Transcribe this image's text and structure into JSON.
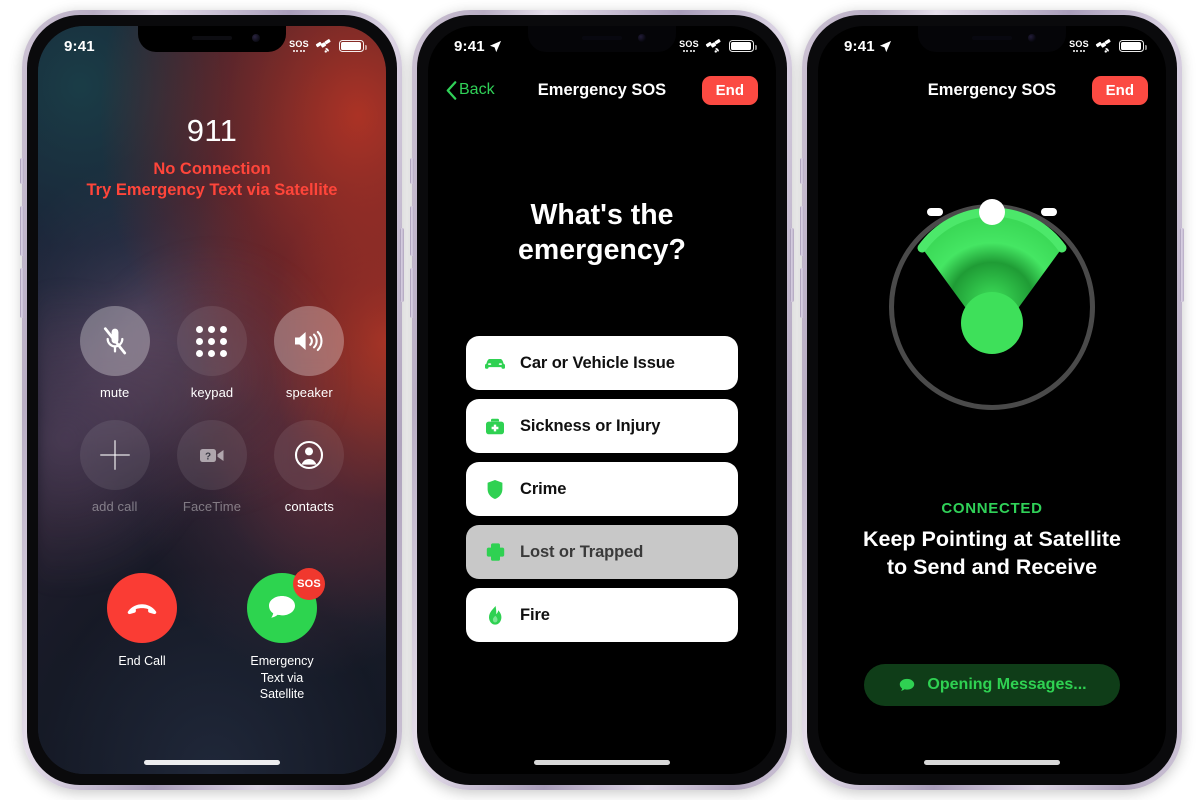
{
  "meta": {
    "accent_green": "#30d158",
    "accent_red": "#fb4a42",
    "bg": "#ffffff"
  },
  "status_bar": {
    "time": "9:41",
    "sos_label": "SOS",
    "location_icon": "location-arrow-icon",
    "satellite_icon": "satellite-icon",
    "battery_icon": "battery-icon"
  },
  "phone1": {
    "screen_name": "in-call-911",
    "call": {
      "number": "911",
      "status_line1": "No Connection",
      "status_line2": "Try Emergency Text via Satellite"
    },
    "controls": [
      {
        "id": "mute",
        "label": "mute",
        "icon": "microphone-slash-icon",
        "state": "on"
      },
      {
        "id": "keypad",
        "label": "keypad",
        "icon": "keypad-icon",
        "state": "off"
      },
      {
        "id": "speaker",
        "label": "speaker",
        "icon": "speaker-wave-icon",
        "state": "on"
      },
      {
        "id": "add-call",
        "label": "add call",
        "icon": "plus-icon",
        "state": "disabled"
      },
      {
        "id": "facetime",
        "label": "FaceTime",
        "icon": "video-camera-icon",
        "state": "disabled"
      },
      {
        "id": "contacts",
        "label": "contacts",
        "icon": "contact-person-icon",
        "state": "off"
      }
    ],
    "end_call": {
      "label": "End Call",
      "icon": "phone-down-icon"
    },
    "emergency_text": {
      "label": "Emergency\nText via\nSatellite",
      "label_l1": "Emergency",
      "label_l2": "Text via",
      "label_l3": "Satellite",
      "badge": "SOS",
      "icon": "message-bubble-icon"
    }
  },
  "phone2": {
    "screen_name": "emergency-sos-questionnaire",
    "nav": {
      "back_label": "Back",
      "title": "Emergency SOS",
      "end_label": "End"
    },
    "question_line1": "What's the",
    "question_line2": "emergency?",
    "options": [
      {
        "label": "Car or Vehicle Issue",
        "icon": "car-icon",
        "selected": false
      },
      {
        "label": "Sickness or Injury",
        "icon": "medical-bag-icon",
        "selected": false
      },
      {
        "label": "Crime",
        "icon": "shield-icon",
        "selected": false
      },
      {
        "label": "Lost or Trapped",
        "icon": "cross-plus-icon",
        "selected": true
      },
      {
        "label": "Fire",
        "icon": "flame-icon",
        "selected": false
      }
    ]
  },
  "phone3": {
    "screen_name": "satellite-pointing",
    "nav": {
      "title": "Emergency SOS",
      "end_label": "End"
    },
    "satellite_indicator": {
      "icon": "satellite-direction-icon",
      "beam_color": "#3ee05a",
      "ring_color": "#4a4a4a"
    },
    "connection_status": "CONNECTED",
    "instruction_line1": "Keep Pointing at Satellite",
    "instruction_line2": "to Send and Receive",
    "action_button": {
      "label": "Opening Messages...",
      "icon": "message-bubble-icon"
    }
  }
}
